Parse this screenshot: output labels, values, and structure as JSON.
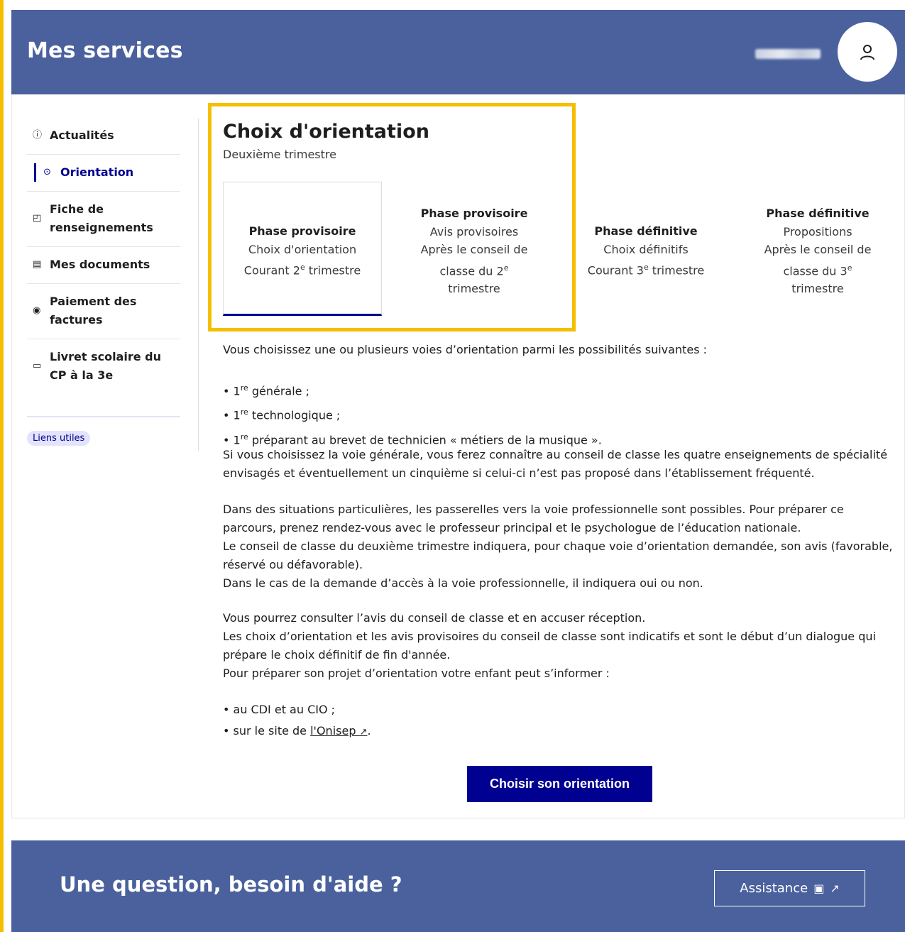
{
  "header": {
    "title": "Mes services"
  },
  "sidebar": {
    "items": [
      {
        "icon": "info-icon",
        "glyph": "ⓘ",
        "label": "Actualités"
      },
      {
        "icon": "compass-icon",
        "glyph": "⊙",
        "label": "Orientation"
      },
      {
        "icon": "form-icon",
        "glyph": "◰",
        "label1": "Fiche de",
        "label2": "renseignements"
      },
      {
        "icon": "document-icon",
        "glyph": "▤",
        "label": "Mes documents"
      },
      {
        "icon": "payment-icon",
        "glyph": "◉",
        "label1": "Paiement des",
        "label2": "factures"
      },
      {
        "icon": "book-icon",
        "glyph": "▭",
        "label1": "Livret scolaire du",
        "label2": "CP à la 3e"
      }
    ],
    "badge": "Liens utiles"
  },
  "content": {
    "title": "Choix d'orientation",
    "subtitle": "Deuxième trimestre"
  },
  "phases": [
    {
      "title": "Phase provisoire",
      "line1": "Choix d'orientation",
      "line2a": "Courant 2",
      "sup": "e",
      "line2b": " trimestre"
    },
    {
      "title": "Phase provisoire",
      "line1": "Avis provisoires",
      "line2": "Après le conseil de",
      "line3a": "classe du 2",
      "sup": "e",
      "line4": "trimestre"
    },
    {
      "title": "Phase définitive",
      "line1": "Choix définitifs",
      "line2a": "Courant 3",
      "sup": "e",
      "line2b": " trimestre"
    },
    {
      "title": "Phase définitive",
      "line1": "Propositions",
      "line2": "Après le conseil de",
      "line3a": "classe du 3",
      "sup": "e",
      "line4": "trimestre"
    }
  ],
  "body": {
    "intro": "Vous choisissez une ou plusieurs voies d’orientation parmi les possibilités suivantes :",
    "bullet_sup": "re",
    "bullets": [
      " générale ;",
      " technologique ;",
      " préparant au brevet de technicien « métiers de la musique »."
    ],
    "bullet_prefix": "• 1",
    "p1_l1": "Si vous choisissez la voie générale, vous ferez connaître au conseil de classe les quatre enseignements de spécialité",
    "p1_l2": "envisagés et éventuellement un cinquième si celui-ci n’est pas proposé dans l’établissement fréquenté.",
    "p2_l1": "Dans des situations particulières, les passerelles vers la voie professionnelle sont possibles. Pour préparer ce",
    "p2_l2": "parcours, prenez rendez-vous avec le professeur principal et le psychologue de l’éducation nationale.",
    "p2_l3": "Le conseil de classe du deuxième trimestre indiquera, pour chaque voie d’orientation demandée, son avis (favorable,",
    "p2_l4": "réservé ou défavorable).",
    "p2_l5": "Dans le cas de la demande d’accès à la voie professionnelle, il indiquera oui ou non.",
    "p3_l1": "Vous pourrez consulter l’avis du conseil de classe et en accuser réception.",
    "p3_l2": "Les choix d’orientation et les avis provisoires du conseil de classe sont indicatifs et sont le début d’un dialogue qui",
    "p3_l3": "prépare le choix définitif de fin d'année.",
    "p3_l4": "Pour préparer son projet d’orientation votre enfant peut s’informer :",
    "info_bullet1": "• au CDI et au CIO ;",
    "info_bullet2_prefix": "• sur le site de ",
    "info_link": "l'Onisep",
    "info_bullet2_suffix": "."
  },
  "cta_label": "Choisir son orientation",
  "footer": {
    "title": "Une question, besoin d'aide ?",
    "assist_label": "Assistance"
  }
}
